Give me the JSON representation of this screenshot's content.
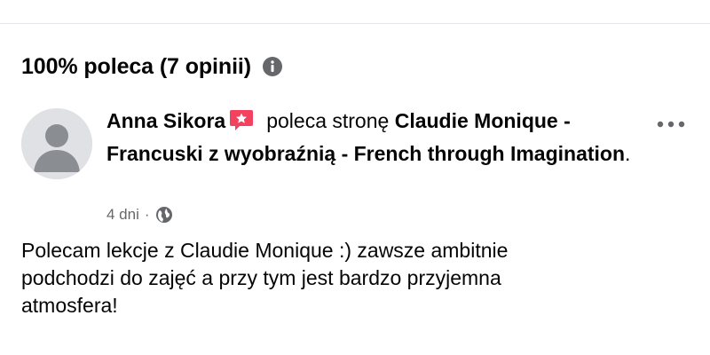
{
  "summary": {
    "text": "100% poleca (7 opinii)",
    "info_icon": "info-icon"
  },
  "review": {
    "author": "Anna Sikora",
    "badge_icon": "star-badge-icon",
    "verb": "poleca stronę",
    "page_name_line": "Claudie Monique - Francuski z wyobraźnią - French through Imagination",
    "period": ".",
    "time": "4 dni",
    "separator": "·",
    "privacy_icon": "globe-icon",
    "more_icon": "more-options-icon",
    "text": "Polecam lekcje z Claudie Monique :) zawsze ambitnie\npodchodzi do zajęć a przy tym jest bardzo przyjemna\natmosfera!"
  },
  "colors": {
    "badge": "#f3425f",
    "secondary_text": "#65676b",
    "primary_text": "#050505"
  }
}
